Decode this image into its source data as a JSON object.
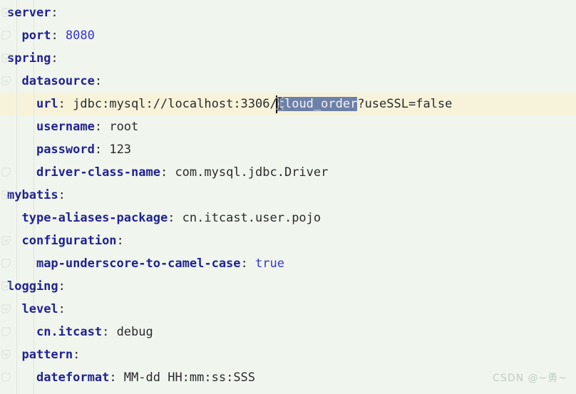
{
  "editor": {
    "language": "yaml",
    "filename_hint": "application.yml",
    "background_color": "#f0f5ee",
    "current_line_color": "#f6f3da",
    "selection_color": "#6d81a8",
    "key_color": "#222290",
    "value_color": "#2b2b2b",
    "number_color": "#3636cc",
    "line_height_px": 32,
    "font_size_px": 17
  },
  "caret": {
    "line_index": 4,
    "column_label": "cloud_order-start"
  },
  "selection": {
    "text": "cloud_order",
    "line_index": 4
  },
  "mouse": {
    "icon": "text-ibeam-cursor"
  },
  "gutter": {
    "fold_icon": "fold-chevron-icon",
    "markers": [
      {
        "line_index": 0,
        "state": "expanded"
      },
      {
        "line_index": 1,
        "state": "leaf"
      },
      {
        "line_index": 2,
        "state": "expanded"
      },
      {
        "line_index": 3,
        "state": "expanded"
      },
      {
        "line_index": 7,
        "state": "leaf"
      },
      {
        "line_index": 8,
        "state": "expanded"
      },
      {
        "line_index": 10,
        "state": "expanded"
      },
      {
        "line_index": 11,
        "state": "leaf"
      },
      {
        "line_index": 12,
        "state": "expanded"
      },
      {
        "line_index": 13,
        "state": "expanded"
      },
      {
        "line_index": 14,
        "state": "leaf"
      },
      {
        "line_index": 15,
        "state": "expanded"
      },
      {
        "line_index": 16,
        "state": "leaf"
      }
    ]
  },
  "lines": [
    {
      "indent": 0,
      "key": "server",
      "punct": ":",
      "value": "",
      "value_type": "none"
    },
    {
      "indent": 1,
      "key": "port",
      "punct": ": ",
      "value": "8080",
      "value_type": "number"
    },
    {
      "indent": 0,
      "key": "spring",
      "punct": ":",
      "value": "",
      "value_type": "none"
    },
    {
      "indent": 1,
      "key": "datasource",
      "punct": ":",
      "value": "",
      "value_type": "none"
    },
    {
      "indent": 2,
      "key": "url",
      "punct": ": ",
      "value": "jdbc:mysql://localhost:3306/cloud_order?useSSL=false",
      "value_type": "string",
      "value_prefix": "jdbc:mysql://localhost:3306/",
      "value_selected": "cloud_order",
      "value_suffix": "?useSSL=false",
      "is_current_line": true
    },
    {
      "indent": 2,
      "key": "username",
      "punct": ": ",
      "value": "root",
      "value_type": "string"
    },
    {
      "indent": 2,
      "key": "password",
      "punct": ": ",
      "value": "123",
      "value_type": "string"
    },
    {
      "indent": 2,
      "key": "driver-class-name",
      "punct": ": ",
      "value": "com.mysql.jdbc.Driver",
      "value_type": "string"
    },
    {
      "indent": 0,
      "key": "mybatis",
      "punct": ":",
      "value": "",
      "value_type": "none"
    },
    {
      "indent": 1,
      "key": "type-aliases-package",
      "punct": ": ",
      "value": "cn.itcast.user.pojo",
      "value_type": "string"
    },
    {
      "indent": 1,
      "key": "configuration",
      "punct": ":",
      "value": "",
      "value_type": "none"
    },
    {
      "indent": 2,
      "key": "map-underscore-to-camel-case",
      "punct": ": ",
      "value": "true",
      "value_type": "boolean"
    },
    {
      "indent": 0,
      "key": "logging",
      "punct": ":",
      "value": "",
      "value_type": "none"
    },
    {
      "indent": 1,
      "key": "level",
      "punct": ":",
      "value": "",
      "value_type": "none"
    },
    {
      "indent": 2,
      "key": "cn.itcast",
      "punct": ": ",
      "value": "debug",
      "value_type": "string"
    },
    {
      "indent": 1,
      "key": "pattern",
      "punct": ":",
      "value": "",
      "value_type": "none"
    },
    {
      "indent": 2,
      "key": "dateformat",
      "punct": ": ",
      "value": "MM-dd HH:mm:ss:SSS",
      "value_type": "string"
    }
  ],
  "watermark": {
    "text": "CSDN @~勇~"
  }
}
